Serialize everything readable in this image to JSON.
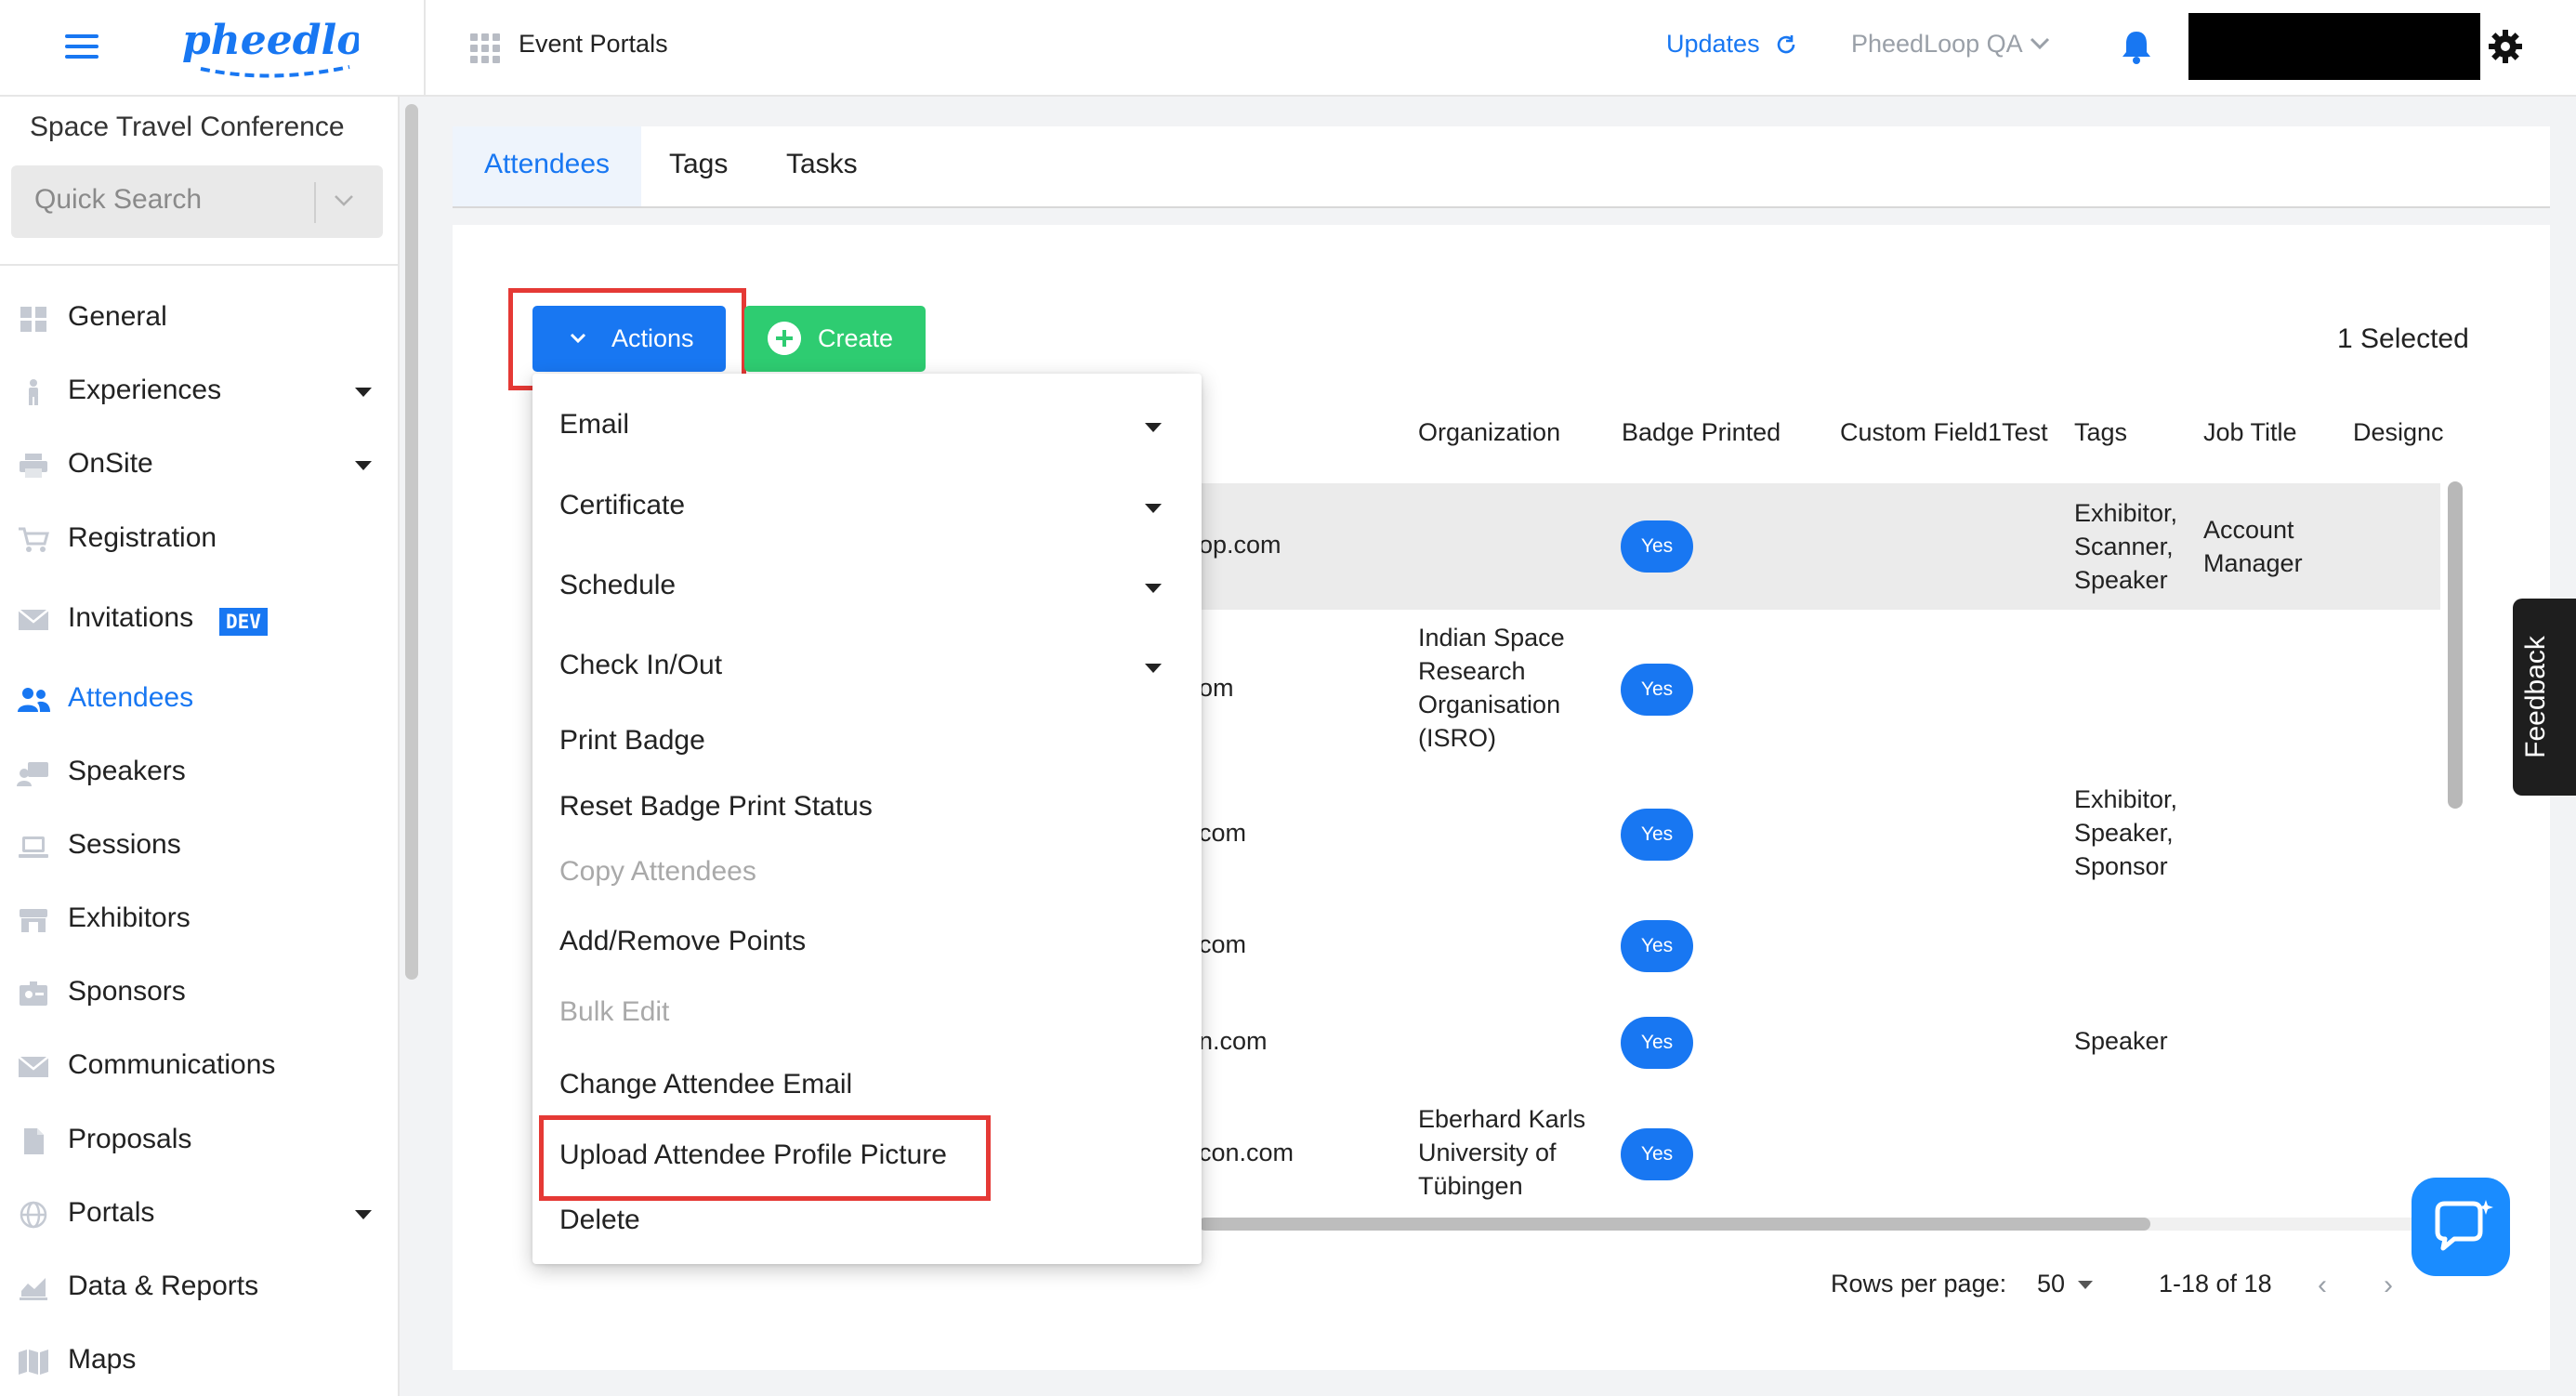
{
  "colors": {
    "primary": "#1877f2",
    "create_green": "#2ecc71",
    "highlight_red": "#e53935"
  },
  "topbar": {
    "brand": "pheedloop",
    "portal_title": "Event Portals",
    "updates_label": "Updates",
    "org_select_label": "PheedLoop QA",
    "icons": {
      "menu": "hamburger-icon",
      "apps": "grid-icon",
      "updates": "refresh-icon",
      "org": "chevron-down-icon",
      "notifications": "bell-icon",
      "settings": "gear-icon"
    }
  },
  "sidebar": {
    "event_name": "Space Travel Conference",
    "quick_search_placeholder": "Quick Search",
    "items": [
      {
        "label": "General",
        "icon": "dashboard-icon",
        "has_caret": false
      },
      {
        "label": "Experiences",
        "icon": "person-icon",
        "has_caret": true
      },
      {
        "label": "OnSite",
        "icon": "printer-icon",
        "has_caret": true
      },
      {
        "label": "Registration",
        "icon": "cart-icon",
        "has_caret": false
      },
      {
        "label": "Invitations",
        "icon": "envelope-icon",
        "has_caret": false,
        "badge": "DEV"
      },
      {
        "label": "Attendees",
        "icon": "people-icon",
        "has_caret": false,
        "active": true
      },
      {
        "label": "Speakers",
        "icon": "speaker-icon",
        "has_caret": false
      },
      {
        "label": "Sessions",
        "icon": "laptop-icon",
        "has_caret": false
      },
      {
        "label": "Exhibitors",
        "icon": "store-icon",
        "has_caret": false
      },
      {
        "label": "Sponsors",
        "icon": "id-badge-icon",
        "has_caret": false
      },
      {
        "label": "Communications",
        "icon": "envelope-icon",
        "has_caret": false
      },
      {
        "label": "Proposals",
        "icon": "document-icon",
        "has_caret": false
      },
      {
        "label": "Portals",
        "icon": "globe-icon",
        "has_caret": true
      },
      {
        "label": "Data & Reports",
        "icon": "chart-icon",
        "has_caret": false
      },
      {
        "label": "Maps",
        "icon": "map-icon",
        "has_caret": false
      }
    ]
  },
  "tabs": [
    {
      "label": "Attendees",
      "active": true
    },
    {
      "label": "Tags",
      "active": false
    },
    {
      "label": "Tasks",
      "active": false
    }
  ],
  "toolbar": {
    "actions_label": "Actions",
    "create_label": "Create",
    "selected_text": "1 Selected"
  },
  "table": {
    "headers": [
      "Organization",
      "Badge Printed",
      "Custom Field1Test",
      "Tags",
      "Job Title",
      "Designc"
    ],
    "rows": [
      {
        "email_fragment": "op.com",
        "organization": [],
        "badge": "Yes",
        "tags": [
          "Exhibitor,",
          "Scanner,",
          "Speaker"
        ],
        "job_title": [
          "Account",
          "Manager"
        ],
        "selected": true
      },
      {
        "email_fragment": "om",
        "organization": [
          "Indian Space",
          "Research",
          "Organisation",
          "(ISRO)"
        ],
        "badge": "Yes",
        "tags": [],
        "job_title": []
      },
      {
        "email_fragment": "com",
        "organization": [],
        "badge": "Yes",
        "tags": [
          "Exhibitor,",
          "Speaker,",
          "Sponsor"
        ],
        "job_title": []
      },
      {
        "email_fragment": "com",
        "organization": [],
        "badge": "Yes",
        "tags": [],
        "job_title": []
      },
      {
        "email_fragment": "n.com",
        "organization": [],
        "badge": "Yes",
        "tags": [
          "Speaker"
        ],
        "job_title": []
      },
      {
        "email_fragment": "con.com",
        "organization": [
          "Eberhard Karls",
          "University of",
          "Tübingen"
        ],
        "badge": "Yes",
        "tags": [],
        "job_title": []
      }
    ]
  },
  "pagination": {
    "rows_per_page_label": "Rows per page:",
    "rows_per_page_value": "50",
    "range_text": "1-18 of 18",
    "prev": "‹",
    "next": "›"
  },
  "actions_menu": {
    "items": [
      {
        "label": "Email",
        "has_caret": true,
        "disabled": false
      },
      {
        "label": "Certificate",
        "has_caret": true,
        "disabled": false
      },
      {
        "label": "Schedule",
        "has_caret": true,
        "disabled": false
      },
      {
        "label": "Check In/Out",
        "has_caret": true,
        "disabled": false
      },
      {
        "label": "Print Badge",
        "has_caret": false,
        "disabled": false
      },
      {
        "label": "Reset Badge Print Status",
        "has_caret": false,
        "disabled": false
      },
      {
        "label": "Copy Attendees",
        "has_caret": false,
        "disabled": true
      },
      {
        "label": "Add/Remove Points",
        "has_caret": false,
        "disabled": false
      },
      {
        "label": "Bulk Edit",
        "has_caret": false,
        "disabled": true
      },
      {
        "label": "Change Attendee Email",
        "has_caret": false,
        "disabled": false
      },
      {
        "label": "Upload Attendee Profile Picture",
        "has_caret": false,
        "disabled": false,
        "highlighted": true
      },
      {
        "label": "Delete",
        "has_caret": false,
        "disabled": false
      }
    ]
  },
  "feedback_label": "Feedback",
  "chat_icon": "chat-bubble-icon"
}
